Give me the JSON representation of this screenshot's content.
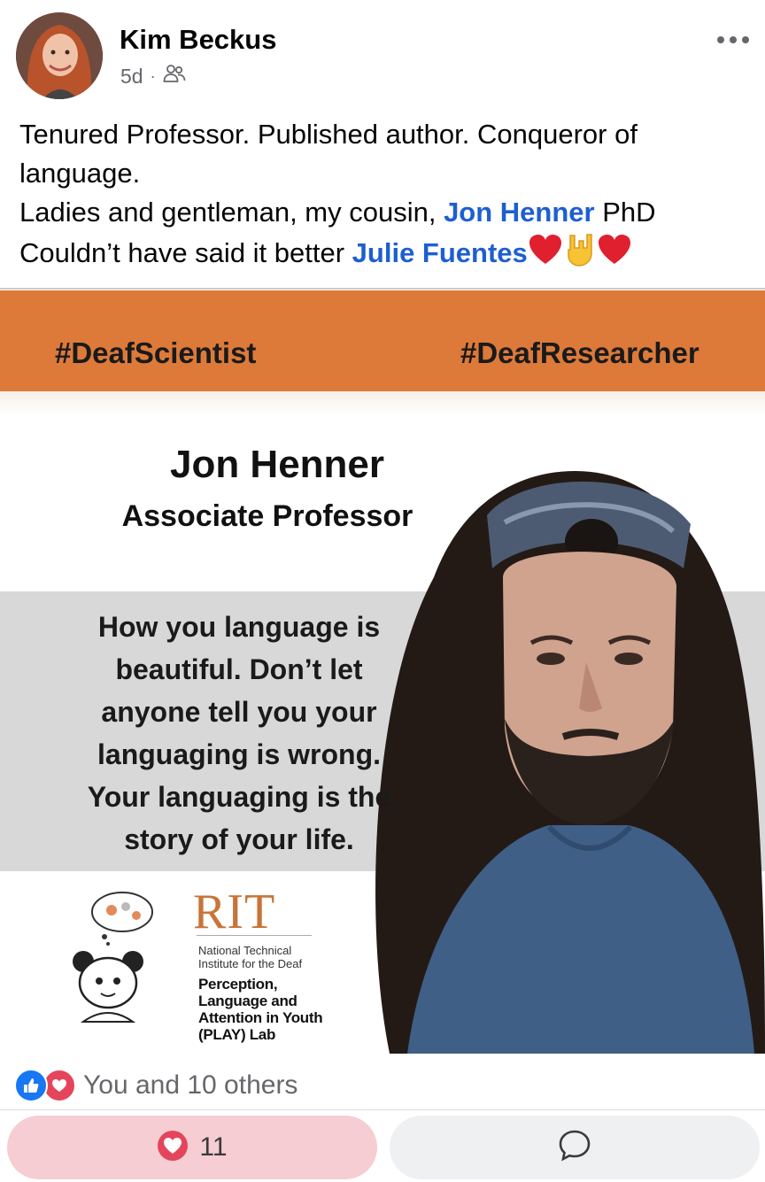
{
  "post": {
    "author": "Kim Beckus",
    "time": "5d",
    "separator": "·",
    "text": {
      "line1": "Tenured Professor. Published author. Conqueror of",
      "line2": "language.",
      "line3_prefix": "Ladies and gentleman,  my cousin,  ",
      "line3_mention": "Jon Henner",
      "line3_suffix": " PhD",
      "line4_prefix": "Couldn’t have said it better ",
      "line4_mention": "Julie Fuentes"
    }
  },
  "image": {
    "hashtag_left": "#DeafScientist",
    "hashtag_right": "#DeafResearcher",
    "name": "Jon Henner",
    "role": "Associate Professor",
    "quote_lines": [
      "How you language is",
      "beautiful. Don’t let",
      "anyone tell you your",
      "languaging is wrong.",
      "Your languaging is the",
      "story of your life."
    ],
    "rit_logo": "RIT",
    "ntid": "National Technical Institute for the Deaf",
    "lab": "Perception, Language and Attention in Youth (PLAY) Lab"
  },
  "reactions": {
    "summary": "You and 10 others",
    "count": "11"
  },
  "icons": {
    "audience": "friends-icon",
    "more": "more-options-icon",
    "like": "like-icon",
    "love": "love-icon",
    "comment": "comment-icon"
  },
  "colors": {
    "mention": "#1d5fd0",
    "banner": "#dd7a3a",
    "like_blue": "#1877f2",
    "love_red": "#e4455b",
    "react_button_bg": "#f5cdd2"
  }
}
